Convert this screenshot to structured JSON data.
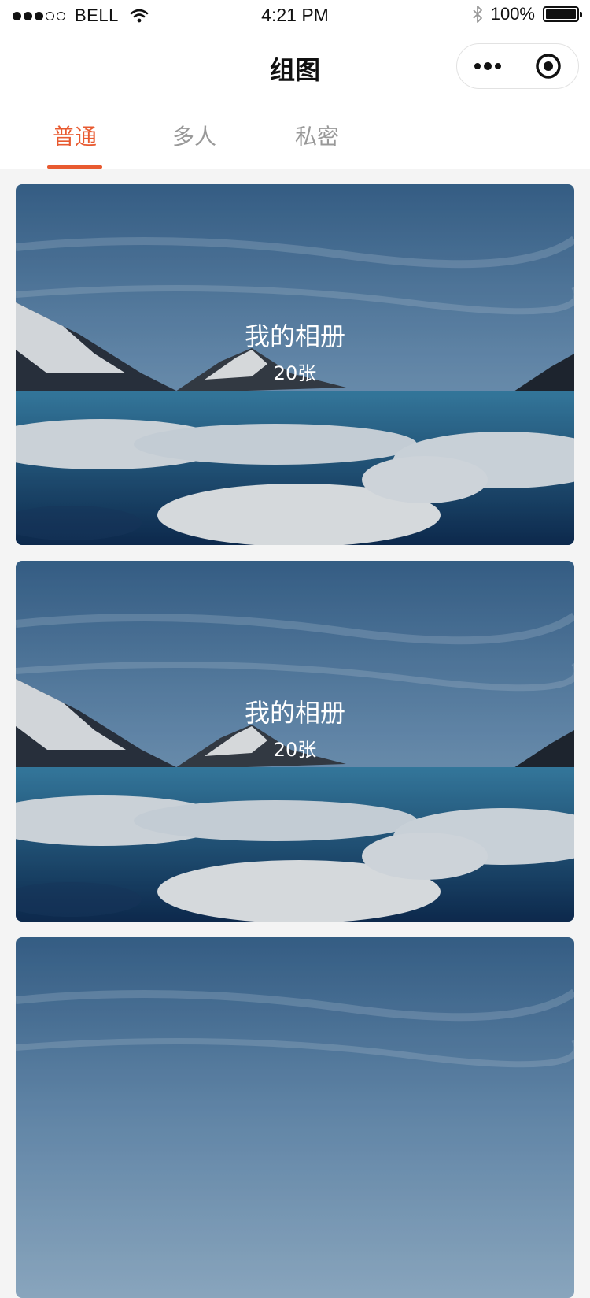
{
  "status_bar": {
    "carrier": "BELL",
    "time": "4:21 PM",
    "battery": "100%",
    "battery_level": 1.0,
    "signal_bars": 3,
    "signal_total": 5
  },
  "nav": {
    "title": "组图",
    "more_icon": "more-dots-icon",
    "close_icon": "target-close-icon"
  },
  "tabs": [
    {
      "label": "普通",
      "active": true
    },
    {
      "label": "多人",
      "active": false
    },
    {
      "label": "私密",
      "active": false
    }
  ],
  "colors": {
    "accent": "#e85a30",
    "tab_inactive": "#999999",
    "background": "#f4f4f4"
  },
  "albums": [
    {
      "title": "我的相册",
      "count": "20张"
    },
    {
      "title": "我的相册",
      "count": "20张"
    },
    {
      "title": "",
      "count": ""
    }
  ]
}
